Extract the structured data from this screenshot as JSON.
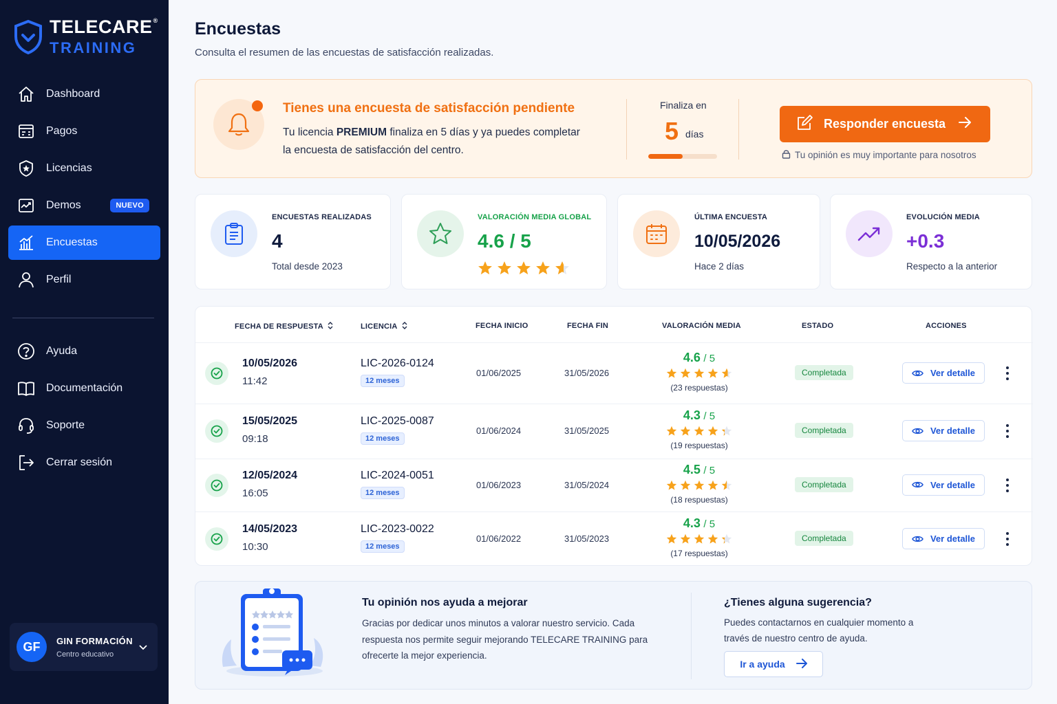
{
  "brand": {
    "line1": "TELECARE",
    "registered": "®",
    "line2": "TRAINING"
  },
  "sidebar": {
    "items": [
      {
        "label": "Dashboard"
      },
      {
        "label": "Pagos"
      },
      {
        "label": "Licencias"
      },
      {
        "label": "Demos",
        "badge": "NUEVO"
      },
      {
        "label": "Encuestas"
      },
      {
        "label": "Perfil"
      }
    ],
    "secondary": [
      {
        "label": "Ayuda"
      },
      {
        "label": "Documentación"
      },
      {
        "label": "Soporte"
      },
      {
        "label": "Cerrar sesión"
      }
    ],
    "user": {
      "initials": "GF",
      "name": "GIN FORMACIÓN",
      "role": "Centro educativo"
    }
  },
  "page": {
    "title": "Encuestas",
    "subtitle": "Consulta el resumen de las encuestas de satisfacción realizadas."
  },
  "alert": {
    "title": "Tienes una encuesta de satisfacción pendiente",
    "text_before": "Tu licencia ",
    "text_bold": "PREMIUM",
    "text_after": " finaliza en 5 días y ya puedes completar la encuesta de satisfacción del centro.",
    "ends_label": "Finaliza en",
    "ends_value": "5",
    "ends_unit": "días",
    "progress": 0.5,
    "button": "Responder encuesta",
    "note": "Tu opinión es muy importante para nosotros"
  },
  "stats": [
    {
      "label": "ENCUESTAS REALIZADAS",
      "value": "4",
      "sub": "Total desde 2023"
    },
    {
      "label": "VALORACIÓN MEDIA GLOBAL",
      "value": "4.6 / 5",
      "stars": 4.6
    },
    {
      "label": "ÚLTIMA ENCUESTA",
      "value": "10/05/2026",
      "sub": "Hace 2 días"
    },
    {
      "label": "EVOLUCIÓN MEDIA",
      "value": "+0.3",
      "sub": "Respecto a la anterior"
    }
  ],
  "table": {
    "headers": [
      "FECHA DE RESPUESTA",
      "LICENCIA",
      "FECHA INICIO",
      "FECHA FIN",
      "VALORACIÓN MEDIA",
      "ESTADO",
      "ACCIONES"
    ],
    "rows": [
      {
        "date": "10/05/2026",
        "time": "11:42",
        "license": "LIC-2026-0124",
        "duration": "12 meses",
        "start": "01/06/2025",
        "end": "31/05/2026",
        "rating": "4.6",
        "scale": "/ 5",
        "rating_value": 4.6,
        "responses": "(23 respuestas)",
        "status": "Completada",
        "action": "Ver detalle"
      },
      {
        "date": "15/05/2025",
        "time": "09:18",
        "license": "LIC-2025-0087",
        "duration": "12 meses",
        "start": "01/06/2024",
        "end": "31/05/2025",
        "rating": "4.3",
        "scale": "/ 5",
        "rating_value": 4.3,
        "responses": "(19 respuestas)",
        "status": "Completada",
        "action": "Ver detalle"
      },
      {
        "date": "12/05/2024",
        "time": "16:05",
        "license": "LIC-2024-0051",
        "duration": "12 meses",
        "start": "01/06/2023",
        "end": "31/05/2024",
        "rating": "4.5",
        "scale": "/ 5",
        "rating_value": 4.5,
        "responses": "(18 respuestas)",
        "status": "Completada",
        "action": "Ver detalle"
      },
      {
        "date": "14/05/2023",
        "time": "10:30",
        "license": "LIC-2023-0022",
        "duration": "12 meses",
        "start": "01/06/2022",
        "end": "31/05/2023",
        "rating": "4.3",
        "scale": "/ 5",
        "rating_value": 4.3,
        "responses": "(17 respuestas)",
        "status": "Completada",
        "action": "Ver detalle"
      }
    ]
  },
  "footer": {
    "title1": "Tu opinión nos ayuda a mejorar",
    "text1": "Gracias por dedicar unos minutos a valorar nuestro servicio. Cada respuesta nos permite seguir mejorando TELECARE TRAINING para ofrecerte la mejor experiencia.",
    "title2": "¿Tienes alguna sugerencia?",
    "text2": "Puedes contactarnos en cualquier momento a través de nuestro centro de ayuda.",
    "button": "Ir a ayuda"
  },
  "colors": {
    "sidebar_bg": "#0b1430",
    "accent_blue": "#1565f5",
    "accent_orange": "#f06812",
    "success_green": "#17a24a",
    "purple": "#7b2fd6",
    "star": "#f7a21b"
  }
}
